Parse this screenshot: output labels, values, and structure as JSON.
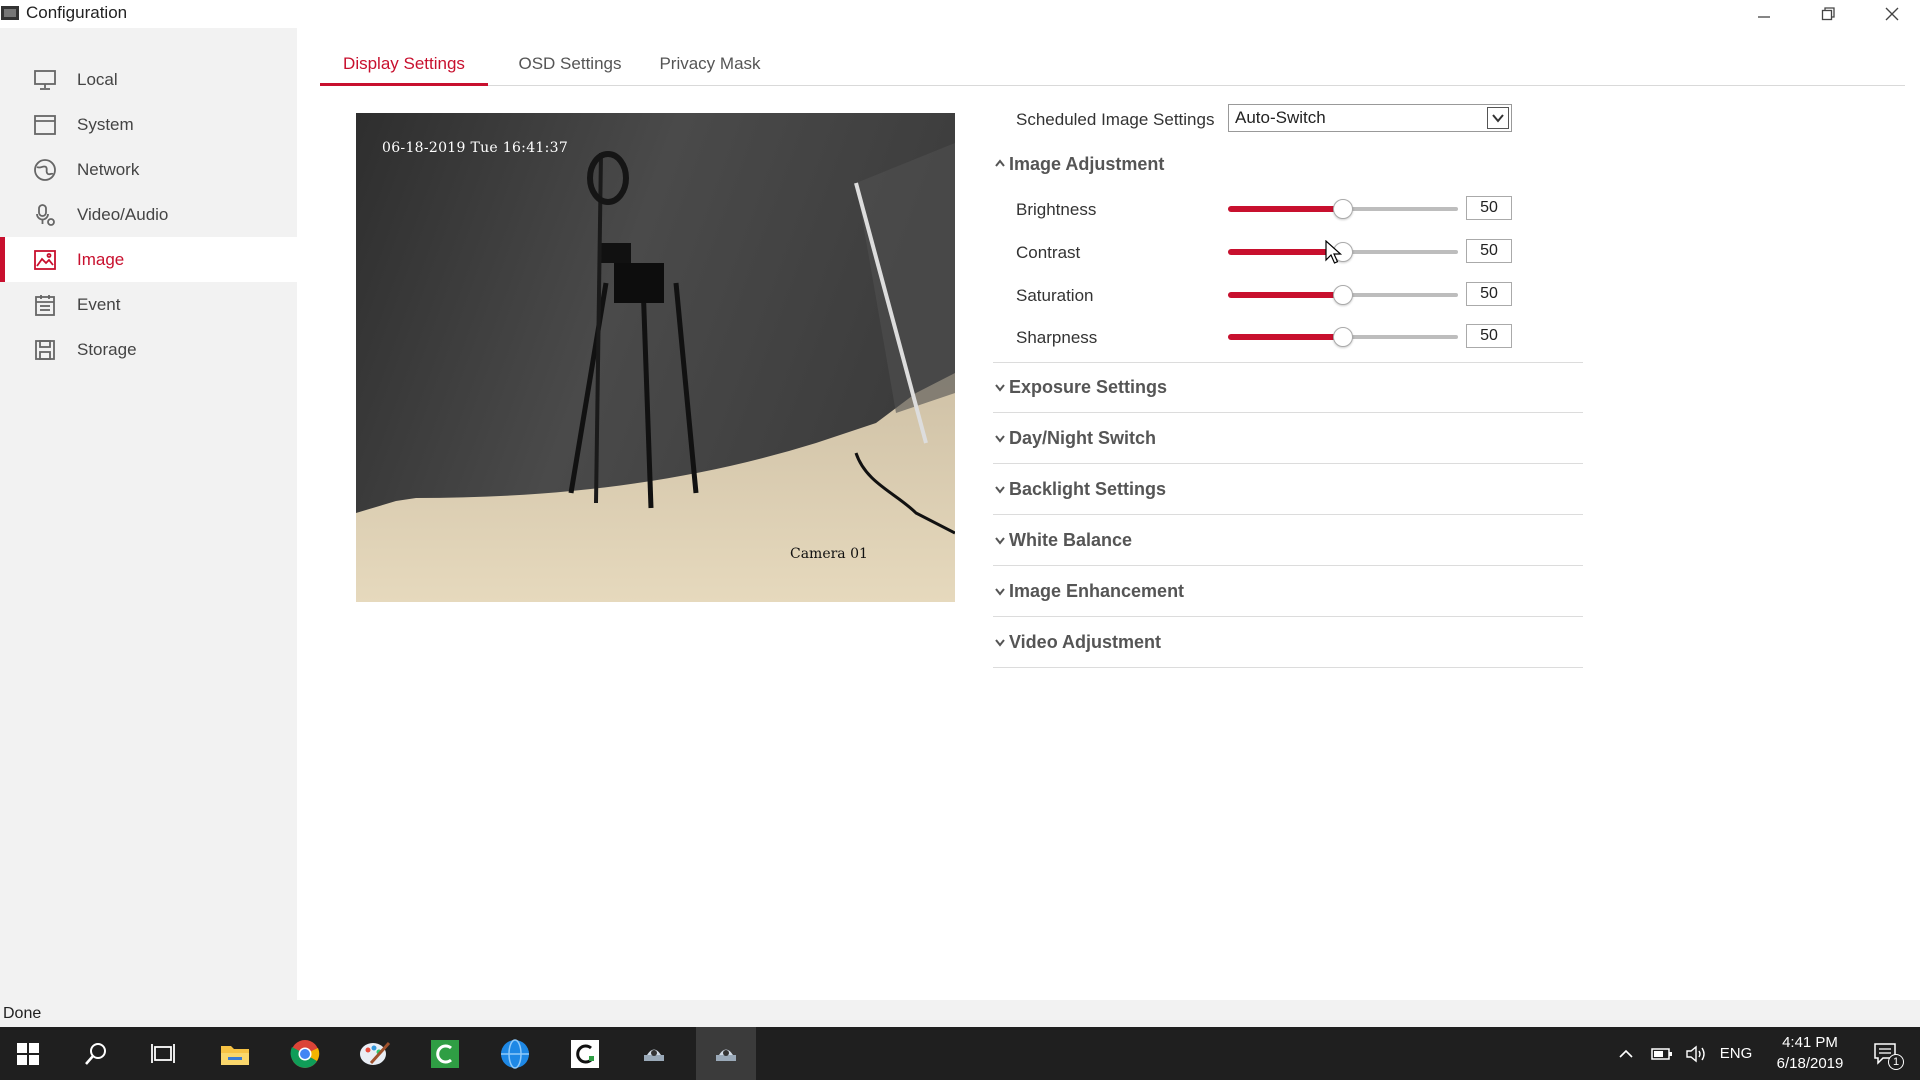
{
  "window": {
    "title": "Configuration",
    "icons": [
      "app-icon",
      "minimize-icon",
      "restore-icon",
      "close-icon"
    ]
  },
  "sidebar": {
    "items": [
      {
        "label": "Local",
        "icon": "monitor-icon"
      },
      {
        "label": "System",
        "icon": "system-icon"
      },
      {
        "label": "Network",
        "icon": "globe-icon"
      },
      {
        "label": "Video/Audio",
        "icon": "microphone-icon"
      },
      {
        "label": "Image",
        "icon": "image-icon",
        "active": true
      },
      {
        "label": "Event",
        "icon": "calendar-icon"
      },
      {
        "label": "Storage",
        "icon": "storage-icon"
      }
    ]
  },
  "tabs": [
    {
      "label": "Display Settings",
      "active": true
    },
    {
      "label": "OSD Settings"
    },
    {
      "label": "Privacy Mask"
    }
  ],
  "preview": {
    "timestamp": "06-18-2019 Tue 16:41:37",
    "camera_name": "Camera 01"
  },
  "scheduled": {
    "label": "Scheduled Image Settings",
    "value": "Auto-Switch"
  },
  "image_adjustment": {
    "title": "Image Adjustment",
    "expanded": true,
    "sliders": [
      {
        "label": "Brightness",
        "value": "50",
        "percent": 50
      },
      {
        "label": "Contrast",
        "value": "50",
        "percent": 50
      },
      {
        "label": "Saturation",
        "value": "50",
        "percent": 50
      },
      {
        "label": "Sharpness",
        "value": "50",
        "percent": 50
      }
    ]
  },
  "sections": [
    {
      "title": "Exposure Settings"
    },
    {
      "title": "Day/Night Switch"
    },
    {
      "title": "Backlight Settings"
    },
    {
      "title": "White Balance"
    },
    {
      "title": "Image Enhancement"
    },
    {
      "title": "Video Adjustment"
    }
  ],
  "status": "Done",
  "taskbar": {
    "apps": [
      "windows-start-icon",
      "search-icon",
      "task-view-icon",
      "file-explorer-icon",
      "chrome-icon",
      "paint-icon",
      "green-c-app-icon",
      "blue-globe-app-icon",
      "black-c-app-icon",
      "camera-app-icon",
      "camera-app-icon"
    ],
    "language": "ENG",
    "time": "4:41 PM",
    "date": "6/18/2019",
    "notification_count": "1"
  },
  "colors": {
    "accent": "#c8102e",
    "sidebar_bg": "#f2f2f2",
    "taskbar_bg": "#1f1f1f"
  }
}
